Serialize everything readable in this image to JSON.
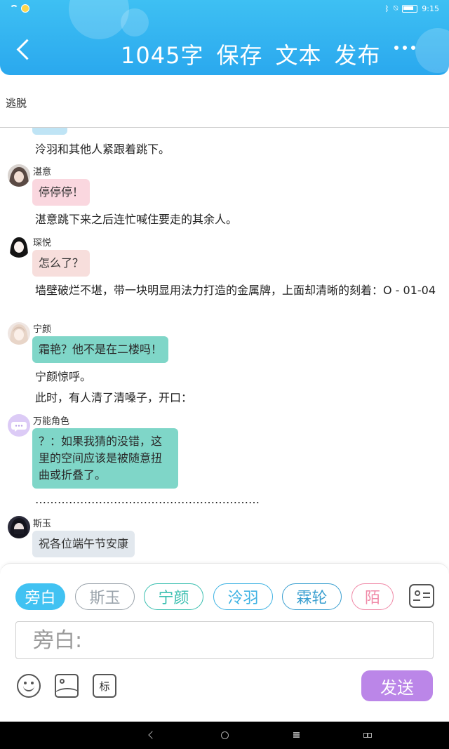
{
  "status": {
    "time": "9:15"
  },
  "header": {
    "word_count": "1045字",
    "save_label": "保存",
    "text_label": "文本",
    "publish_label": "发布"
  },
  "doc": {
    "title": "逃脱"
  },
  "chat": [
    {
      "kind": "narration",
      "text": "泠羽和其他人紧跟着跳下。"
    },
    {
      "kind": "message",
      "name": "湛意",
      "text": "停停停！",
      "color": "#fad7df"
    },
    {
      "kind": "narration",
      "text": "湛意跳下来之后连忙喊住要走的其余人。"
    },
    {
      "kind": "message",
      "name": "琛悦",
      "text": "怎么了？",
      "color": "#f7dedc"
    },
    {
      "kind": "narration",
      "text": "墙壁破烂不堪，带一块明显用法力打造的金属牌，上面却清晰的刻着：O - 01-04"
    },
    {
      "kind": "message",
      "name": "宁颜",
      "text": "霜艳？他不是在二楼吗！",
      "color": "#7fd6c8"
    },
    {
      "kind": "narration",
      "text": "宁颜惊呼。"
    },
    {
      "kind": "narration",
      "text": "此时，有人清了清嗓子，开口："
    },
    {
      "kind": "message",
      "name": "万能角色",
      "text": "？：如果我猜的没错，这里的空间应该是被随意扭曲或折叠了。",
      "color": "#7fd6c8"
    },
    {
      "kind": "narration",
      "text": "……………………………………………………"
    },
    {
      "kind": "message",
      "name": "斯玉",
      "text": "祝各位端午节安康",
      "color": "#e2e8ee"
    }
  ],
  "roles": [
    {
      "label": "旁白",
      "color": "#41c2f2",
      "active": true
    },
    {
      "label": "斯玉",
      "color": "#9aa3ab",
      "active": false
    },
    {
      "label": "宁颜",
      "color": "#3bbfb0",
      "active": false
    },
    {
      "label": "泠羽",
      "color": "#3fb3e3",
      "active": false
    },
    {
      "label": "霖轮",
      "color": "#3a9fd0",
      "active": false
    },
    {
      "label": "陌",
      "color": "#f08aa8",
      "active": false
    }
  ],
  "input": {
    "placeholder": "旁白:"
  },
  "toolbar": {
    "tag_label": "标",
    "send_label": "发送"
  }
}
